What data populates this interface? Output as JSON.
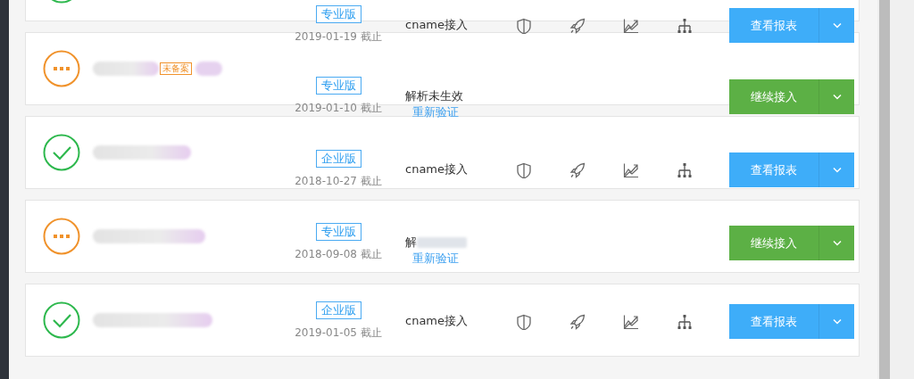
{
  "rows": [
    {
      "kind": "ok",
      "name_redacted": false,
      "record_badge": null,
      "plan": "专业版",
      "expiry": "2019-01-19 截止",
      "access": "cname接入",
      "access_redacted": false,
      "link": null,
      "tools_shown": true,
      "action": {
        "kind": "report",
        "label": "查看报表"
      }
    },
    {
      "kind": "pending",
      "name_redacted": true,
      "record_badge": "未备案",
      "plan": "专业版",
      "expiry": "2019-01-10 截止",
      "access": "解析未生效",
      "access_redacted": false,
      "link": "重新验证",
      "tools_shown": false,
      "action": {
        "kind": "continue",
        "label": "继续接入"
      }
    },
    {
      "kind": "ok",
      "name_redacted": true,
      "record_badge": null,
      "plan": "企业版",
      "expiry": "2018-10-27 截止",
      "access": "cname接入",
      "access_redacted": false,
      "link": null,
      "tools_shown": true,
      "action": {
        "kind": "report",
        "label": "查看报表"
      }
    },
    {
      "kind": "pending",
      "name_redacted": true,
      "record_badge": null,
      "plan": "专业版",
      "expiry": "2018-09-08 截止",
      "access": "解",
      "access_redacted": true,
      "link": "重新验证",
      "tools_shown": false,
      "action": {
        "kind": "continue",
        "label": "继续接入"
      }
    },
    {
      "kind": "ok",
      "name_redacted": true,
      "record_badge": null,
      "plan": "企业版",
      "expiry": "2019-01-05 截止",
      "access": "cname接入",
      "access_redacted": false,
      "link": null,
      "tools_shown": true,
      "action": {
        "kind": "report",
        "label": "查看报表"
      }
    }
  ]
}
